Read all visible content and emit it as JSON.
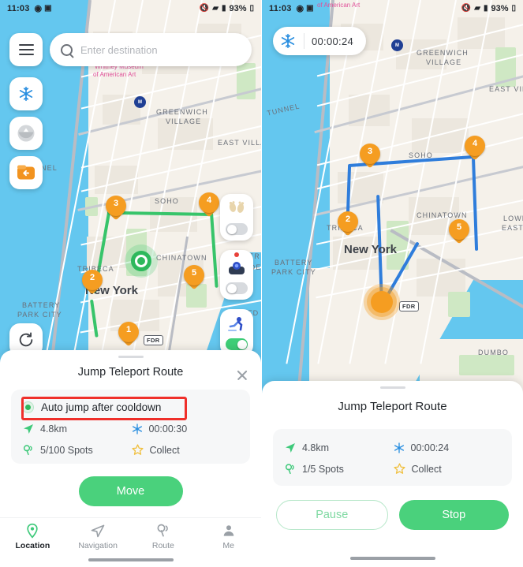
{
  "left": {
    "status": {
      "time": "11:03",
      "battery": "93%",
      "icons": [
        "location-icon",
        "gallery-icon",
        "mute-icon",
        "wifi-icon",
        "signal-icon",
        "battery-icon"
      ]
    },
    "search": {
      "placeholder": "Enter destination",
      "menu_icon": "hamburger-icon",
      "search_icon": "search-icon"
    },
    "left_controls": [
      {
        "name": "freeze-teleport-button",
        "icon": "snowflake-icon"
      },
      {
        "name": "joystick-button",
        "icon": "compass-icon"
      },
      {
        "name": "route-folder-button",
        "icon": "folder-back-icon"
      }
    ],
    "refresh_button": {
      "name": "refresh-button",
      "icon": "refresh-icon"
    },
    "right_controls": [
      {
        "name": "footprint-toggle",
        "icon": "footprints-icon",
        "on": false
      },
      {
        "name": "joystick-toggle",
        "icon": "joystick-icon",
        "on": false,
        "badge": true
      },
      {
        "name": "walk-speed-toggle",
        "icon": "runner-icon",
        "on": true
      }
    ],
    "map": {
      "labels": [
        {
          "text": "Whitney Museum",
          "kind": "pink"
        },
        {
          "text": "of American Art",
          "kind": "pink"
        },
        {
          "text": "GREENWICH",
          "kind": "area"
        },
        {
          "text": "VILLAGE",
          "kind": "area"
        },
        {
          "text": "EAST VILLA",
          "kind": "area"
        },
        {
          "text": "SOHO",
          "kind": "area"
        },
        {
          "text": "CHINATOWN",
          "kind": "area"
        },
        {
          "text": "TRIBECA",
          "kind": "area"
        },
        {
          "text": "BATTERY",
          "kind": "area"
        },
        {
          "text": "PARK CITY",
          "kind": "area"
        },
        {
          "text": "NEL",
          "kind": "area"
        },
        {
          "text": "VER",
          "kind": "area"
        },
        {
          "text": "SIDE",
          "kind": "area"
        },
        {
          "text": "FD",
          "kind": "area"
        },
        {
          "text": "New York",
          "kind": "city"
        }
      ],
      "shield": "FDR",
      "pins": [
        "1",
        "2",
        "3",
        "4",
        "5"
      ],
      "route_color": "#37c46a",
      "pin_color": "#f59d21"
    },
    "sheet": {
      "title": "Jump Teleport Route",
      "close_icon": "close-icon",
      "option_label": "Auto jump after cooldown",
      "stats": [
        {
          "icon": "navigation-arrow-icon",
          "value": "4.8km"
        },
        {
          "icon": "snowflake-icon",
          "value": "00:00:30"
        },
        {
          "icon": "spots-icon",
          "value": "5/100 Spots"
        },
        {
          "icon": "star-icon",
          "value": "Collect"
        }
      ],
      "primary_button": "Move"
    },
    "tabs": [
      {
        "label": "Location",
        "icon": "pin-icon",
        "active": true
      },
      {
        "label": "Navigation",
        "icon": "paper-plane-icon",
        "active": false
      },
      {
        "label": "Route",
        "icon": "route-icon",
        "active": false
      },
      {
        "label": "Me",
        "icon": "person-icon",
        "active": false
      }
    ]
  },
  "right": {
    "status": {
      "time": "11:03",
      "battery": "93%"
    },
    "timer_chip": {
      "icon": "snowflake-icon",
      "value": "00:00:24"
    },
    "map": {
      "labels": [
        {
          "text": "of American Art",
          "kind": "pink"
        },
        {
          "text": "GREENWICH",
          "kind": "area"
        },
        {
          "text": "VILLAGE",
          "kind": "area"
        },
        {
          "text": "EAST VILL",
          "kind": "area"
        },
        {
          "text": "TUNNEL",
          "kind": "area"
        },
        {
          "text": "SOHO",
          "kind": "area"
        },
        {
          "text": "CHINATOWN",
          "kind": "area"
        },
        {
          "text": "TRIBECA",
          "kind": "area"
        },
        {
          "text": "LOWE",
          "kind": "area"
        },
        {
          "text": "EAST S",
          "kind": "area"
        },
        {
          "text": "BATTERY",
          "kind": "area"
        },
        {
          "text": "PARK CITY",
          "kind": "area"
        },
        {
          "text": "DUMBO",
          "kind": "area"
        },
        {
          "text": "New York",
          "kind": "city"
        }
      ],
      "shield": "FDR",
      "pins": [
        "2",
        "3",
        "4",
        "5"
      ],
      "route_color": "#2f7ddb",
      "pin_color": "#f59d21"
    },
    "sheet": {
      "title": "Jump Teleport Route",
      "stats": [
        {
          "icon": "navigation-arrow-icon",
          "value": "4.8km"
        },
        {
          "icon": "snowflake-icon",
          "value": "00:00:24"
        },
        {
          "icon": "spots-icon",
          "value": "1/5 Spots"
        },
        {
          "icon": "star-icon",
          "value": "Collect"
        }
      ],
      "pause_button": "Pause",
      "stop_button": "Stop"
    }
  },
  "annotation": {
    "color": "#ef2f2a",
    "target": "auto-jump-after-cooldown-option"
  }
}
